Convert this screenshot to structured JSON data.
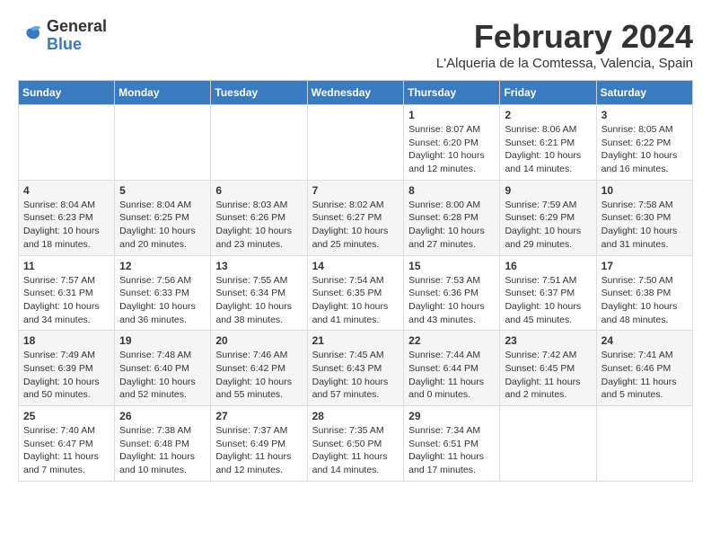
{
  "header": {
    "logo": {
      "general": "General",
      "blue": "Blue"
    },
    "title": "February 2024",
    "location": "L'Alqueria de la Comtessa, Valencia, Spain"
  },
  "calendar": {
    "days_of_week": [
      "Sunday",
      "Monday",
      "Tuesday",
      "Wednesday",
      "Thursday",
      "Friday",
      "Saturday"
    ],
    "weeks": [
      [
        {
          "day": "",
          "info": ""
        },
        {
          "day": "",
          "info": ""
        },
        {
          "day": "",
          "info": ""
        },
        {
          "day": "",
          "info": ""
        },
        {
          "day": "1",
          "info": "Sunrise: 8:07 AM\nSunset: 6:20 PM\nDaylight: 10 hours\nand 12 minutes."
        },
        {
          "day": "2",
          "info": "Sunrise: 8:06 AM\nSunset: 6:21 PM\nDaylight: 10 hours\nand 14 minutes."
        },
        {
          "day": "3",
          "info": "Sunrise: 8:05 AM\nSunset: 6:22 PM\nDaylight: 10 hours\nand 16 minutes."
        }
      ],
      [
        {
          "day": "4",
          "info": "Sunrise: 8:04 AM\nSunset: 6:23 PM\nDaylight: 10 hours\nand 18 minutes."
        },
        {
          "day": "5",
          "info": "Sunrise: 8:04 AM\nSunset: 6:25 PM\nDaylight: 10 hours\nand 20 minutes."
        },
        {
          "day": "6",
          "info": "Sunrise: 8:03 AM\nSunset: 6:26 PM\nDaylight: 10 hours\nand 23 minutes."
        },
        {
          "day": "7",
          "info": "Sunrise: 8:02 AM\nSunset: 6:27 PM\nDaylight: 10 hours\nand 25 minutes."
        },
        {
          "day": "8",
          "info": "Sunrise: 8:00 AM\nSunset: 6:28 PM\nDaylight: 10 hours\nand 27 minutes."
        },
        {
          "day": "9",
          "info": "Sunrise: 7:59 AM\nSunset: 6:29 PM\nDaylight: 10 hours\nand 29 minutes."
        },
        {
          "day": "10",
          "info": "Sunrise: 7:58 AM\nSunset: 6:30 PM\nDaylight: 10 hours\nand 31 minutes."
        }
      ],
      [
        {
          "day": "11",
          "info": "Sunrise: 7:57 AM\nSunset: 6:31 PM\nDaylight: 10 hours\nand 34 minutes."
        },
        {
          "day": "12",
          "info": "Sunrise: 7:56 AM\nSunset: 6:33 PM\nDaylight: 10 hours\nand 36 minutes."
        },
        {
          "day": "13",
          "info": "Sunrise: 7:55 AM\nSunset: 6:34 PM\nDaylight: 10 hours\nand 38 minutes."
        },
        {
          "day": "14",
          "info": "Sunrise: 7:54 AM\nSunset: 6:35 PM\nDaylight: 10 hours\nand 41 minutes."
        },
        {
          "day": "15",
          "info": "Sunrise: 7:53 AM\nSunset: 6:36 PM\nDaylight: 10 hours\nand 43 minutes."
        },
        {
          "day": "16",
          "info": "Sunrise: 7:51 AM\nSunset: 6:37 PM\nDaylight: 10 hours\nand 45 minutes."
        },
        {
          "day": "17",
          "info": "Sunrise: 7:50 AM\nSunset: 6:38 PM\nDaylight: 10 hours\nand 48 minutes."
        }
      ],
      [
        {
          "day": "18",
          "info": "Sunrise: 7:49 AM\nSunset: 6:39 PM\nDaylight: 10 hours\nand 50 minutes."
        },
        {
          "day": "19",
          "info": "Sunrise: 7:48 AM\nSunset: 6:40 PM\nDaylight: 10 hours\nand 52 minutes."
        },
        {
          "day": "20",
          "info": "Sunrise: 7:46 AM\nSunset: 6:42 PM\nDaylight: 10 hours\nand 55 minutes."
        },
        {
          "day": "21",
          "info": "Sunrise: 7:45 AM\nSunset: 6:43 PM\nDaylight: 10 hours\nand 57 minutes."
        },
        {
          "day": "22",
          "info": "Sunrise: 7:44 AM\nSunset: 6:44 PM\nDaylight: 11 hours\nand 0 minutes."
        },
        {
          "day": "23",
          "info": "Sunrise: 7:42 AM\nSunset: 6:45 PM\nDaylight: 11 hours\nand 2 minutes."
        },
        {
          "day": "24",
          "info": "Sunrise: 7:41 AM\nSunset: 6:46 PM\nDaylight: 11 hours\nand 5 minutes."
        }
      ],
      [
        {
          "day": "25",
          "info": "Sunrise: 7:40 AM\nSunset: 6:47 PM\nDaylight: 11 hours\nand 7 minutes."
        },
        {
          "day": "26",
          "info": "Sunrise: 7:38 AM\nSunset: 6:48 PM\nDaylight: 11 hours\nand 10 minutes."
        },
        {
          "day": "27",
          "info": "Sunrise: 7:37 AM\nSunset: 6:49 PM\nDaylight: 11 hours\nand 12 minutes."
        },
        {
          "day": "28",
          "info": "Sunrise: 7:35 AM\nSunset: 6:50 PM\nDaylight: 11 hours\nand 14 minutes."
        },
        {
          "day": "29",
          "info": "Sunrise: 7:34 AM\nSunset: 6:51 PM\nDaylight: 11 hours\nand 17 minutes."
        },
        {
          "day": "",
          "info": ""
        },
        {
          "day": "",
          "info": ""
        }
      ]
    ]
  }
}
